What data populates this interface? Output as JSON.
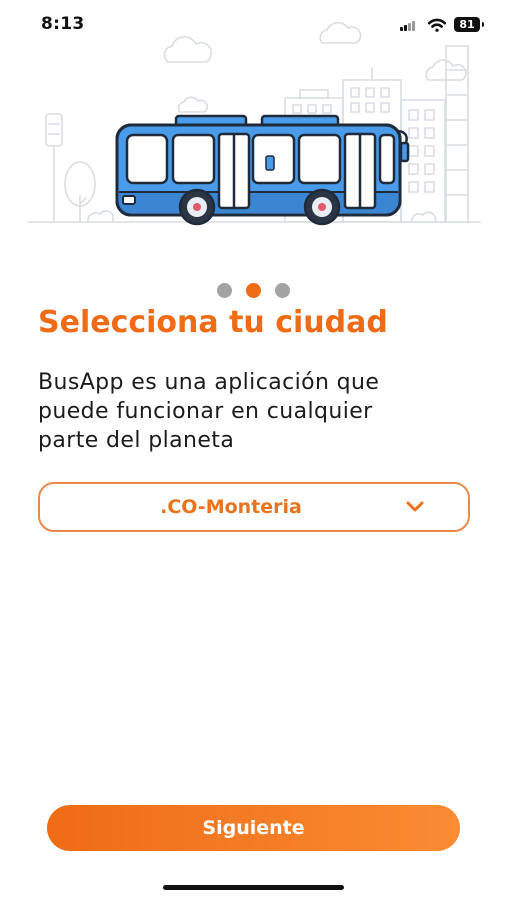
{
  "status_bar": {
    "time": "8:13",
    "battery": "81",
    "icons": [
      "cellular-signal-icon",
      "wifi-icon",
      "battery-icon"
    ]
  },
  "illustration": {
    "icon": "bus-city-illustration"
  },
  "pagination": {
    "count": 3,
    "active": 1
  },
  "title": "Selecciona tu ciudad",
  "description": [
    "BusApp es una aplicación que",
    "puede funcionar en cualquier",
    "parte del planeta"
  ],
  "city_select": {
    "value": ".CO-Monteria",
    "icon": "chevron-down-icon"
  },
  "next_button": {
    "label": "Siguiente"
  },
  "colors": {
    "accent": "#EF6B16",
    "accent_light": "#FA8C33",
    "bus": "#4A9CEA",
    "bus_dark": "#3B86D3",
    "text": "#1C1C1E"
  }
}
